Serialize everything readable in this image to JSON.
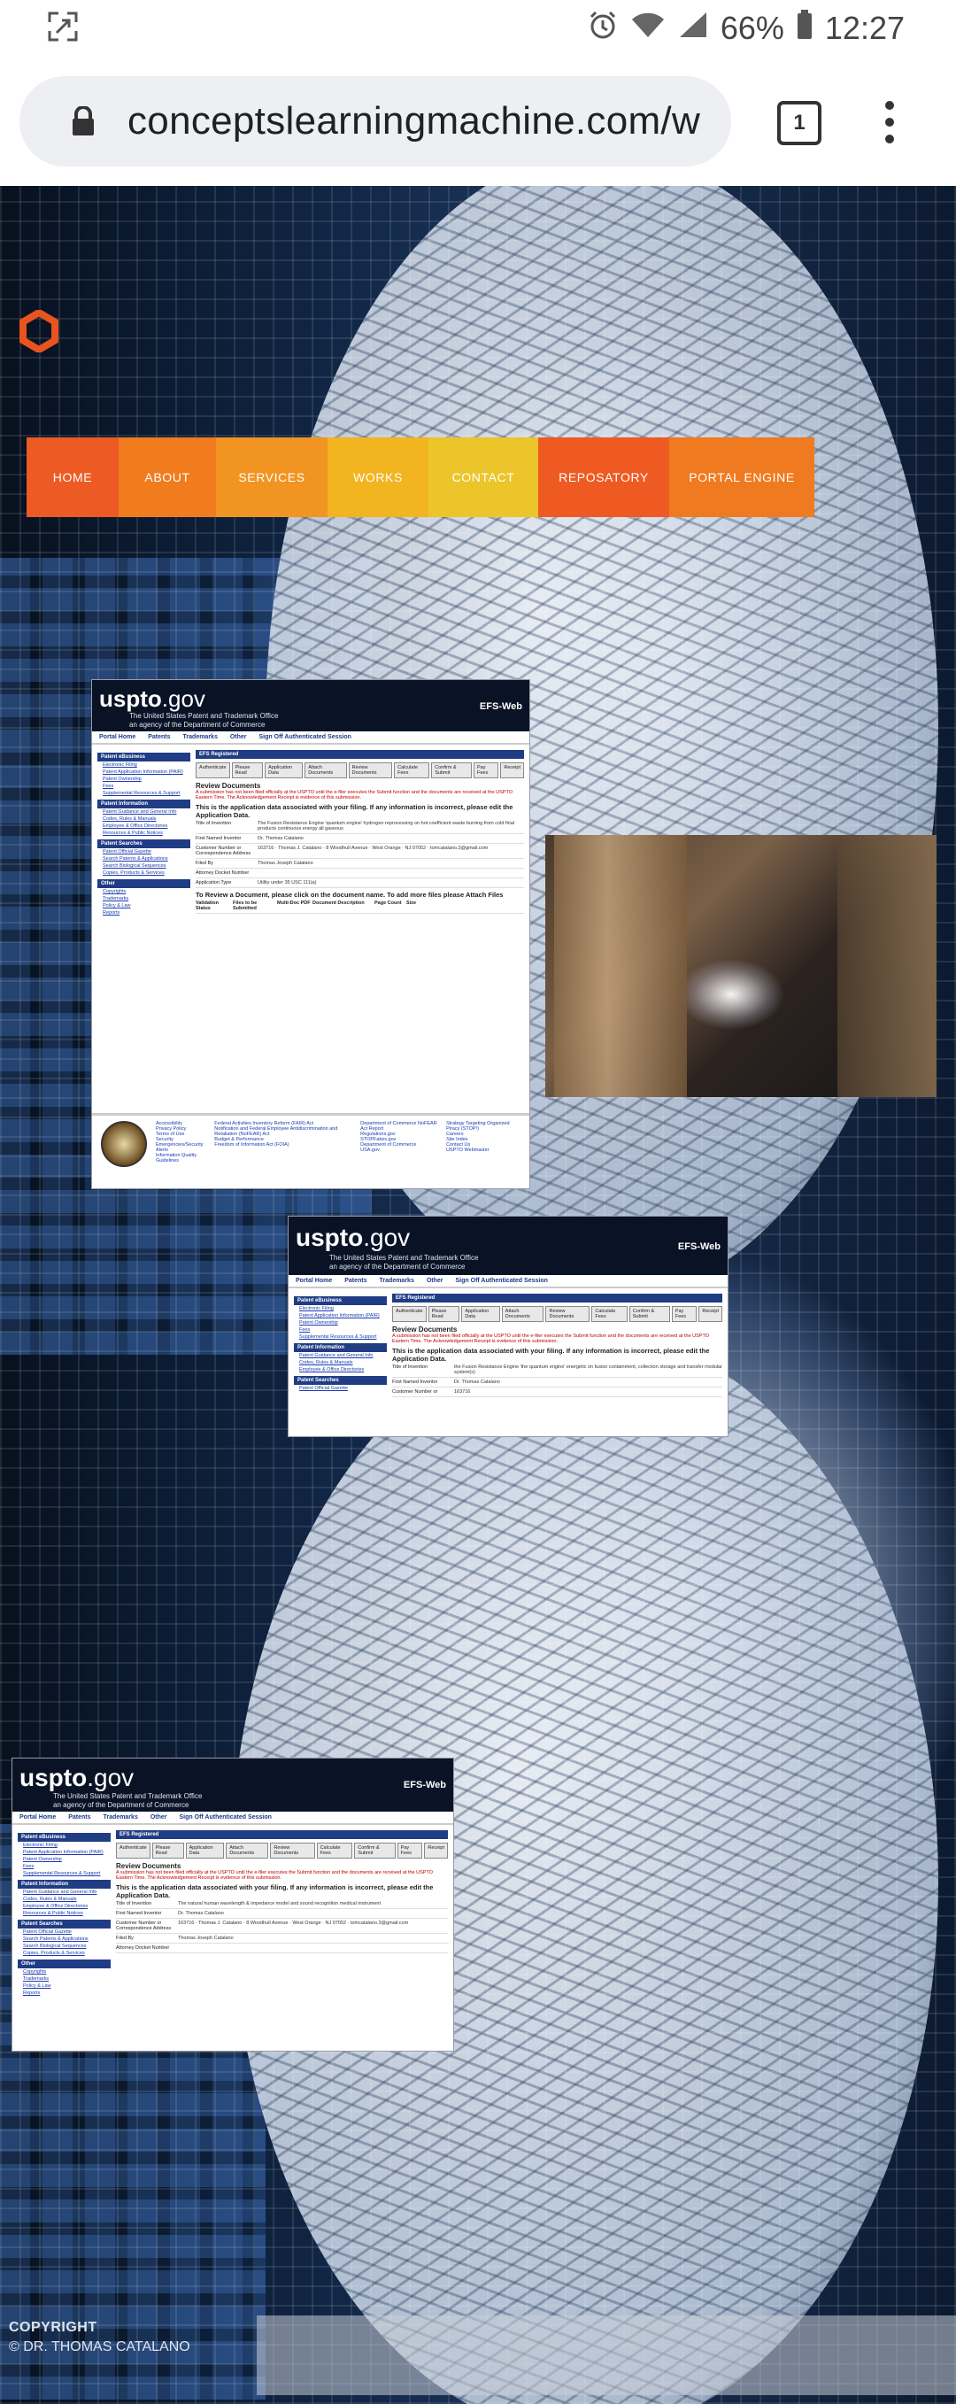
{
  "status_bar": {
    "battery": "66%",
    "time": "12:27",
    "icons": [
      "screenshot-icon",
      "alarm-icon",
      "wifi-icon",
      "signal-icon",
      "battery-icon"
    ]
  },
  "browser": {
    "url": "conceptslearningmachine.com/w",
    "tab_count": "1"
  },
  "nav": {
    "items": [
      {
        "label": "HOME",
        "color": "#ee5a24"
      },
      {
        "label": "ABOUT",
        "color": "#f07c1e"
      },
      {
        "label": "SERVICES",
        "color": "#f29422"
      },
      {
        "label": "WORKS",
        "color": "#f2b41f"
      },
      {
        "label": "CONTACT",
        "color": "#ecc52a"
      },
      {
        "label": "REPOSATORY",
        "color": "#ef5a23"
      },
      {
        "label": "PORTAL ENGINE",
        "color": "#f07a1f"
      }
    ]
  },
  "uspto": {
    "logo_main": "uspto",
    "logo_gov": ".gov",
    "subtitle_1": "The United States Patent and Trademark Office",
    "subtitle_2": "an agency of the Department of Commerce",
    "efs": "EFS-Web",
    "menu": [
      "Portal Home",
      "Patents",
      "Trademarks",
      "Other",
      "Sign Off Authenticated Session"
    ],
    "side_heading_1": "Patent eBusiness",
    "side_items_1": [
      "Electronic Filing",
      "Patent Application Information (PAIR)",
      "Patent Ownership",
      "Fees",
      "Supplemental Resources & Support"
    ],
    "side_heading_2": "Patent Information",
    "side_items_2": [
      "Patent Guidance and General Info",
      "Codes, Rules & Manuals",
      "Employee & Office Directories",
      "Resources & Public Notices"
    ],
    "side_heading_3": "Patent Searches",
    "side_items_3": [
      "Patent Official Gazette",
      "Search Patents & Applications",
      "Search Biological Sequences",
      "Copies, Products & Services"
    ],
    "side_heading_4": "Other",
    "side_items_4": [
      "Copyrights",
      "Trademarks",
      "Policy & Law",
      "Reports"
    ],
    "main_heading": "EFS Registered",
    "tabs": [
      "Authenticate",
      "Please Read",
      "Application Data",
      "Attach Documents",
      "Review Documents",
      "Calculate Fees",
      "Confirm & Submit",
      "Pay Fees",
      "Receipt"
    ],
    "review_title": "Review Documents",
    "warning": "A submission has not been filed officially at the USPTO until the e-filer executes the Submit function and the documents are received at the USPTO Eastern Time. The Acknowledgement Receipt is evidence of this submission.",
    "app_data_notice": "This is the application data associated with your filing. If any information is incorrect, please edit the Application Data.",
    "fields_1": [
      {
        "k": "Title of Invention",
        "v": "The Fusion Resistance Engine 'quantum engine' hydrogen reprocessing on hot coefficient waste burning from cold final products continuous energy all gaseous"
      },
      {
        "k": "First Named Inventor",
        "v": "Dr. Thomas Catalano"
      },
      {
        "k": "Customer Number or Correspondence Address",
        "v": "163716 · Thomas J. Catalano · 8 Woodhull Avenue · West Orange · NJ 07052 · tomcatalano.3@gmail.com"
      },
      {
        "k": "Filed By",
        "v": "Thomas Joseph Catalano"
      },
      {
        "k": "Attorney Docket Number",
        "v": ""
      },
      {
        "k": "Application Type",
        "v": "Utility under 35 USC 111(a)"
      }
    ],
    "doc_notice": "To Review a Document, please click on the document name. To add more files please Attach Files",
    "doc_columns": [
      "Validation Status",
      "Files to be Submitted",
      "Multi-Doc PDF",
      "Document Description",
      "Page Count",
      "Size"
    ],
    "footer_links": [
      "Accessibility",
      "Privacy Policy",
      "Terms of Use",
      "Security",
      "Emergencies/Security Alerts",
      "Information Quality Guidelines",
      "Federal Activities Inventory Reform (FAIR) Act",
      "Notification and Federal Employee Antidiscrimination and Retaliation (NoFEAR) Act",
      "Budget & Performance",
      "Freedom of Information Act (FOIA)",
      "Department of Commerce NoFEAR Act Report",
      "Regulations.gov",
      "STOPFakes.gov",
      "Department of Commerce",
      "USA.gov",
      "Strategy Targeting Organized Piracy (STOP!)",
      "Careers",
      "Site Index",
      "Contact Us",
      "USPTO Webmaster"
    ],
    "fields_2": [
      {
        "k": "Title of Invention",
        "v": "the Fusion Resistance Engine 'the quantum engine' energetic on fusion containment, collection storage and transfer modular system(s)"
      },
      {
        "k": "First Named Inventor",
        "v": "Dr. Thomas Catalano"
      },
      {
        "k": "Customer Number or",
        "v": "163716"
      }
    ],
    "fields_3": [
      {
        "k": "Title of Invention",
        "v": "The natural human wavelength & impedance model and sound recognition medical instrument"
      },
      {
        "k": "First Named Inventor",
        "v": "Dr. Thomas Catalano"
      },
      {
        "k": "Customer Number or Correspondence Address",
        "v": "163716 · Thomas J. Catalano · 8 Woodhull Avenue · West Orange · NJ 07052 · tomcatalano.3@gmail.com"
      },
      {
        "k": "Filed By",
        "v": "Thomas Joseph Catalano"
      },
      {
        "k": "Attorney Docket Number",
        "v": ""
      }
    ]
  },
  "footer": {
    "line1": "COPYRIGHT",
    "line2": "© DR. THOMAS CATALANO"
  }
}
